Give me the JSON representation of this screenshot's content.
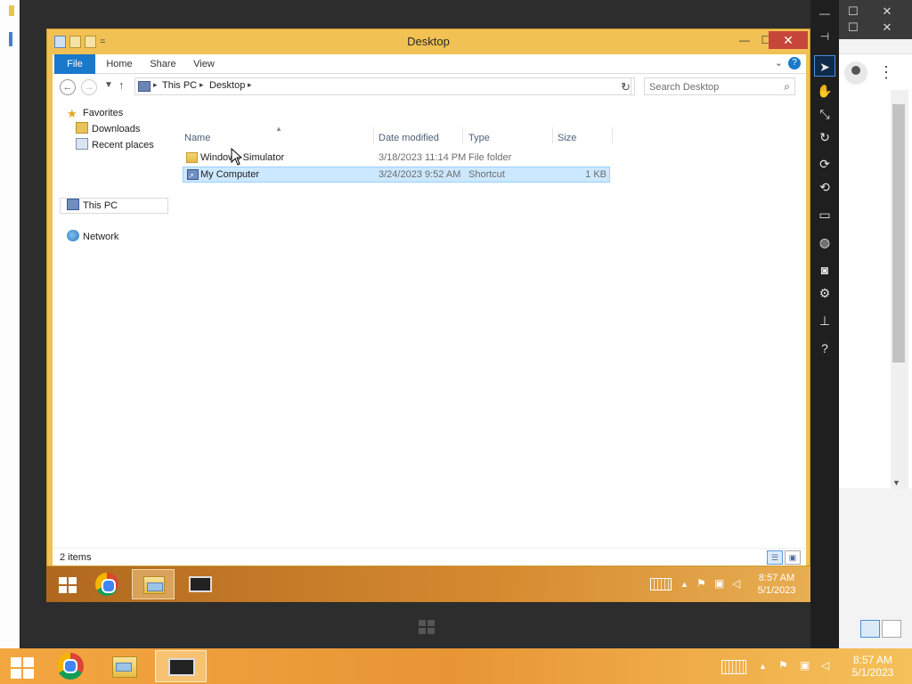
{
  "explorer": {
    "title": "Desktop",
    "qat_chevron": "=",
    "tabs": [
      "File",
      "Home",
      "Share",
      "View"
    ],
    "breadcrumb": [
      "This PC",
      "Desktop"
    ],
    "search_placeholder": "Search Desktop",
    "nav_pane": {
      "favorites": "Favorites",
      "downloads": "Downloads",
      "recent": "Recent places",
      "this_pc": "This PC",
      "network": "Network"
    },
    "columns": [
      "Name",
      "Date modified",
      "Type",
      "Size"
    ],
    "files": [
      {
        "name": "Windows Simulator",
        "date": "3/18/2023 11:14 PM",
        "type": "File folder",
        "size": ""
      },
      {
        "name": "My Computer",
        "date": "3/24/2023 9:52 AM",
        "type": "Shortcut",
        "size": "1 KB"
      }
    ],
    "status": "2 items"
  },
  "inner_taskbar": {
    "time": "8:57 AM",
    "date": "5/1/2023"
  },
  "outer_taskbar": {
    "time": "8:57 AM",
    "date": "5/1/2023"
  },
  "colors": {
    "ribbon_file_tab": "#1979ca",
    "selection": "#cce8ff",
    "close_button": "#c7463b",
    "taskbar_orange": "#e89535"
  },
  "icons": {
    "simulator_tools": [
      "pointer-icon",
      "hand-icon",
      "pinch-icon",
      "rotate-touch-icon",
      "rotate-clockwise-icon",
      "rotate-counterclockwise-icon",
      "resolution-icon",
      "network-icon",
      "screenshot-icon",
      "settings-icon",
      "pin-icon",
      "help-icon"
    ]
  }
}
